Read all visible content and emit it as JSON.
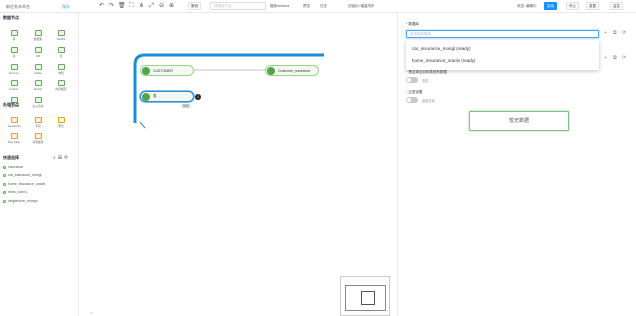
{
  "header": {
    "title": "新任务未命名",
    "save_label": "保存",
    "reset_button": "撤销",
    "select_placeholder": "请选择节点",
    "infer_schema_button": "推断schema",
    "preview_button": "预览",
    "log_button": "日志",
    "init_sync_button": "初始化+增量同步",
    "status_text": "状态: 编辑中",
    "start_button": "启动",
    "stop_button": "停止",
    "reset_state_button": "重置",
    "monitor_button": "监控"
  },
  "sidebar": {
    "data_nodes_title": "数据节点",
    "data_nodes": [
      "库",
      "数据集",
      "GridFS",
      "表",
      "API",
      "流",
      "Dummy",
      "Kafka",
      "未知",
      "Custom",
      "RedisI",
      "内存缓存",
      "数据API",
      "主从合并"
    ],
    "process_nodes_title": "处理节点",
    "process_nodes": [
      "JavaScript",
      "字段",
      "聚合",
      "Row Filter",
      "关联缓存"
    ],
    "quick_select_title": "快速选择",
    "tables": [
      "insurance",
      "car_insurance_mongl",
      "home_insurance_oracle",
      "redis_conn1",
      "singlestore_mongo"
    ]
  },
  "canvas": {
    "source_node": "CUSTOMER",
    "target_node": "Customer_insurance",
    "new_node": "表",
    "badge": "1",
    "preview_tag": "预览"
  },
  "panel": {
    "db_label": "数据库",
    "db_placeholder": "请选择数据库",
    "options": [
      "car_insurance_mongl (ready)",
      "home_insurance_oracle (ready)"
    ],
    "drop_label": "是否清空目标表现有数据",
    "drop_toggle_label": "清空",
    "filter_label": "过滤设置",
    "filter_toggle_label": "启用过滤",
    "empty_button": "暂无数据"
  },
  "colors": {
    "accent": "#1890ff",
    "node_green": "#52a447",
    "edge_blue": "#1a8fd5"
  }
}
